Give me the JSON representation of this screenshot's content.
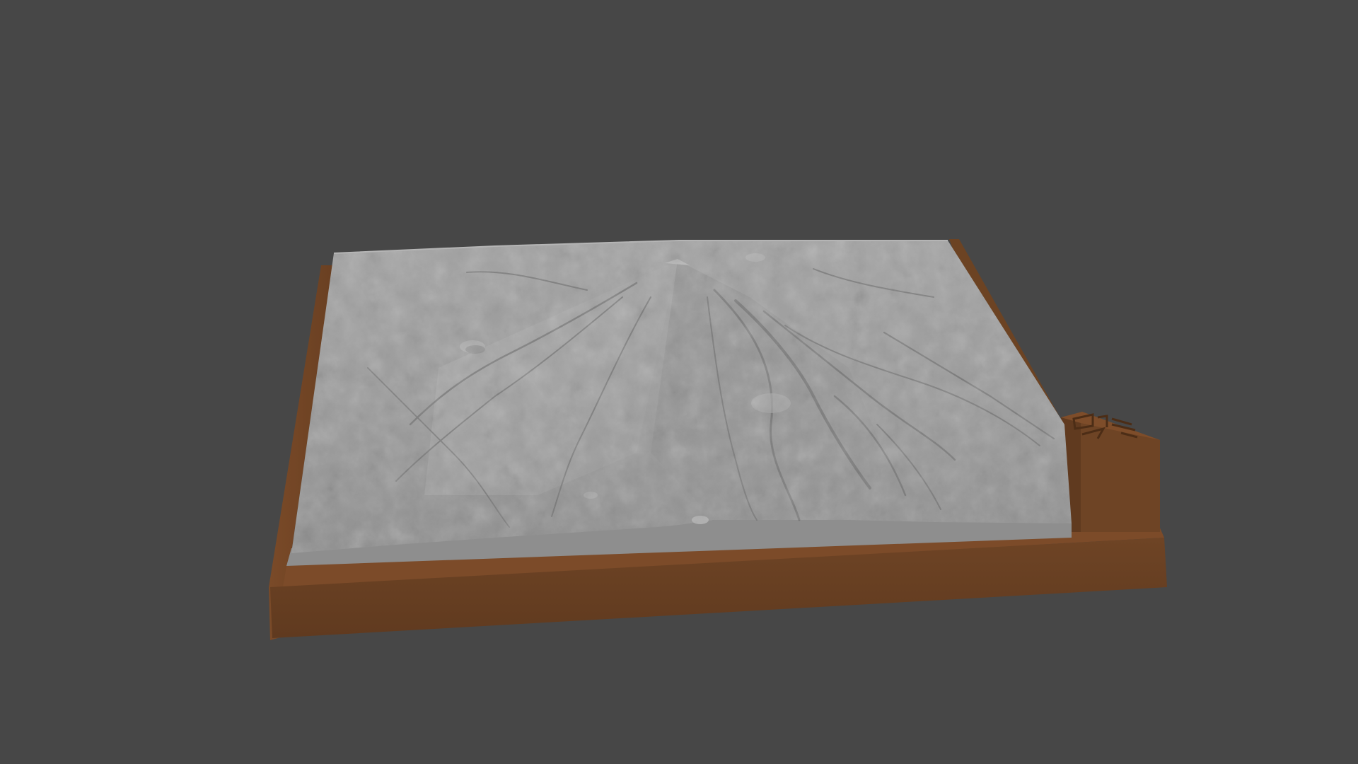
{
  "viewport": {
    "background_color": "#474747"
  },
  "model": {
    "subject": "terrain-relief-model",
    "terrain_color": "#9c9c9c",
    "base_color": "#6b4123",
    "plate_color": "#7a4a28"
  }
}
